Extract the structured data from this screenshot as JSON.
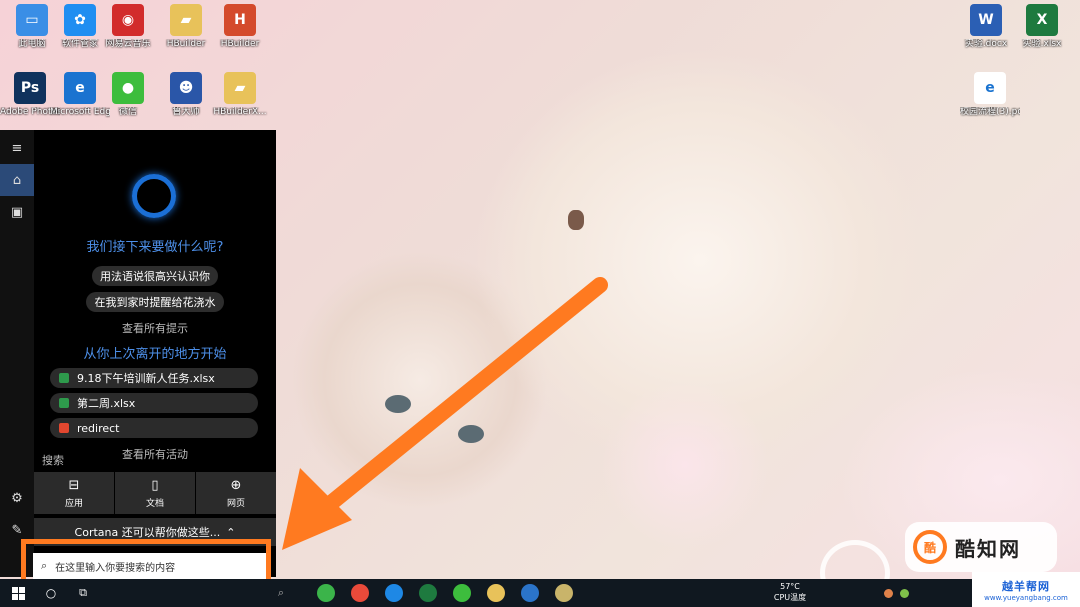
{
  "desktop_icons_left": [
    {
      "label": "此电脑",
      "color": "#3a8ee6",
      "glyph": "▭"
    },
    {
      "label": "软件管家",
      "color": "#1f8ef1",
      "glyph": "✿"
    },
    {
      "label": "网易云音乐",
      "color": "#d22b2b",
      "glyph": "◉"
    },
    {
      "label": "HBuilder",
      "color": "#e8c25a",
      "glyph": "▰"
    },
    {
      "label": "HBuilder",
      "color": "#d44a2b",
      "glyph": "H"
    },
    {
      "label": "Adobe Photosh...",
      "color": "#10325d",
      "glyph": "Ps"
    },
    {
      "label": "Microsoft Edge",
      "color": "#1a73d0",
      "glyph": "e"
    },
    {
      "label": "微信",
      "color": "#3dbd3d",
      "glyph": "●"
    },
    {
      "label": "鲁大师",
      "color": "#2a56a8",
      "glyph": "☻"
    },
    {
      "label": "HBuilderX...",
      "color": "#e8c25a",
      "glyph": "▰"
    }
  ],
  "desktop_icons_right": [
    {
      "label": "实验.docx",
      "color": "#2b5fb4",
      "glyph": "W"
    },
    {
      "label": "实验.xlsx",
      "color": "#1e7a3f",
      "glyph": "X"
    },
    {
      "label": "校园流程(3).pdf",
      "color": "#ffffff",
      "glyph": "e"
    }
  ],
  "cortana": {
    "question": "我们接下来要做什么呢?",
    "suggestions": [
      "用法语说很高兴认识你",
      "在我到家时提醒给花浇水"
    ],
    "see_all_tips": "查看所有提示",
    "resume_heading": "从你上次离开的地方开始",
    "recent": [
      {
        "label": "9.18下午培训新人任务.xlsx",
        "color": "#2e9a4c"
      },
      {
        "label": "第二周.xlsx",
        "color": "#2e9a4c"
      },
      {
        "label": "redirect",
        "color": "#e2472f"
      }
    ],
    "see_all_activity": "查看所有活动",
    "search_label": "搜索",
    "categories": [
      {
        "label": "应用",
        "icon": "app-icon",
        "glyph": "⊟"
      },
      {
        "label": "文档",
        "icon": "document-icon",
        "glyph": "▯"
      },
      {
        "label": "网页",
        "icon": "globe-icon",
        "glyph": "⊕"
      }
    ],
    "more_label": "Cortana 还可以帮你做这些...",
    "rail": [
      {
        "icon": "hamburger-icon",
        "glyph": "≡"
      },
      {
        "icon": "home-icon",
        "glyph": "⌂"
      },
      {
        "icon": "notebook-icon",
        "glyph": "▣"
      }
    ],
    "rail_bottom": [
      {
        "icon": "settings-icon",
        "glyph": "⚙"
      },
      {
        "icon": "feedback-icon",
        "glyph": "✎"
      }
    ]
  },
  "search": {
    "placeholder": "在这里输入你要搜索的内容"
  },
  "taskbar": {
    "cpu_temp": "57°C",
    "cpu_label": "CPU温度",
    "apps": [
      {
        "name": "chrome",
        "color": "#3bb44a"
      },
      {
        "name": "chrome2",
        "color": "#e94a3a"
      },
      {
        "name": "sogou",
        "color": "#1e88e5"
      },
      {
        "name": "excel",
        "color": "#1e7a3f"
      },
      {
        "name": "wechat",
        "color": "#3dbd3d"
      },
      {
        "name": "explorer",
        "color": "#e8c25a"
      },
      {
        "name": "mail",
        "color": "#2b74c9"
      },
      {
        "name": "app",
        "color": "#c9b46a"
      }
    ]
  },
  "watermark": {
    "brand": "酷知网",
    "brand_short": "酷",
    "site_name": "越羊帮网",
    "site_url": "www.yueyangbang.com"
  },
  "colors": {
    "accent": "#ff7a20",
    "cortana_blue": "#1b6fd6"
  }
}
